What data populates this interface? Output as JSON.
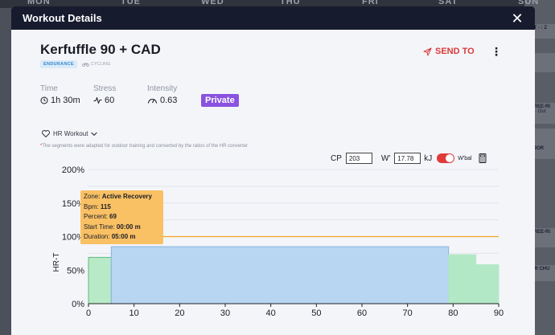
{
  "background": {
    "days": [
      "MON",
      "TUE",
      "WED",
      "THU",
      "FRI",
      "SAT",
      "SUN"
    ],
    "cards": [
      {
        "title": "FT - : Z",
        "sub": "",
        "top": 30,
        "height": 18,
        "green": false
      },
      {
        "title": "",
        "sub": "",
        "top": 66,
        "height": 24,
        "green": false
      },
      {
        "title": "FREE-RI",
        "sub": "h · Out",
        "top": 128,
        "height": 26,
        "green": false
      },
      {
        "title": "",
        "sub": "",
        "top": 160,
        "height": 20,
        "green": false
      },
      {
        "title": "- JOR",
        "sub": "",
        "top": 180,
        "height": 18,
        "green": true
      },
      {
        "title": "FREE-RI",
        "sub": "",
        "top": 284,
        "height": 24,
        "green": false
      },
      {
        "title": "AR CHU",
        "sub": "",
        "top": 330,
        "height": 20,
        "green": false
      }
    ]
  },
  "modal": {
    "title": "Workout Details",
    "close_icon": "close-icon"
  },
  "workout": {
    "name": "Kerfuffle 90 + CAD",
    "tag": "ENDURANCE",
    "sport": "CYCLING",
    "send_label": "SEND TO",
    "stats": {
      "time_label": "Time",
      "time_value": "1h 30m",
      "stress_label": "Stress",
      "stress_value": "60",
      "intensity_label": "Intensity",
      "intensity_value": "0.63"
    },
    "privacy": "Private",
    "hr_label": "HR Workout",
    "note_star": "*",
    "note": "The segments were adapted for outdoor training and converted by the ratios of the HR converter"
  },
  "controls": {
    "cp_label": "CP",
    "cp_value": "203",
    "w_label": "W'",
    "w_value": "17.78",
    "w_unit": "kJ",
    "wbal_label": "W'bal",
    "wbal_on": true
  },
  "chart_data": {
    "type": "area",
    "ylabel": "HR-T",
    "xlim": [
      0,
      90
    ],
    "ylim": [
      0,
      200
    ],
    "x_ticks": [
      0,
      10,
      20,
      30,
      40,
      50,
      60,
      70,
      80,
      90
    ],
    "y_ticks": [
      0,
      50,
      100,
      150,
      200
    ],
    "y_tick_labels": [
      "0%",
      "50%",
      "100%",
      "150%",
      "200%"
    ],
    "reference_line": {
      "value": 100,
      "color": "#f4a623"
    },
    "segments": [
      {
        "start": 0,
        "end": 5,
        "value": 69,
        "color": "#b8eac8",
        "stroke": "#5fba7d"
      },
      {
        "start": 5,
        "end": 79,
        "value": 85,
        "color": "#b8d6f2",
        "stroke": "#86b4e0"
      },
      {
        "start": 79,
        "end": 85,
        "value": 73,
        "color": "#b3e8c6",
        "stroke": "#b3e8c6"
      },
      {
        "start": 85,
        "end": 90,
        "value": 58,
        "color": "#b3e8c6",
        "stroke": "#b3e8c6"
      }
    ],
    "grid": true
  },
  "tooltip": {
    "zone_label": "Zone:",
    "zone_value": "Active Recovery",
    "bpm_label": "Bpm:",
    "bpm_value": "115",
    "percent_label": "Percent:",
    "percent_value": "69",
    "start_label": "Start Time:",
    "start_value": "00:00 m",
    "duration_label": "Duration:",
    "duration_value": "05:00 m"
  }
}
